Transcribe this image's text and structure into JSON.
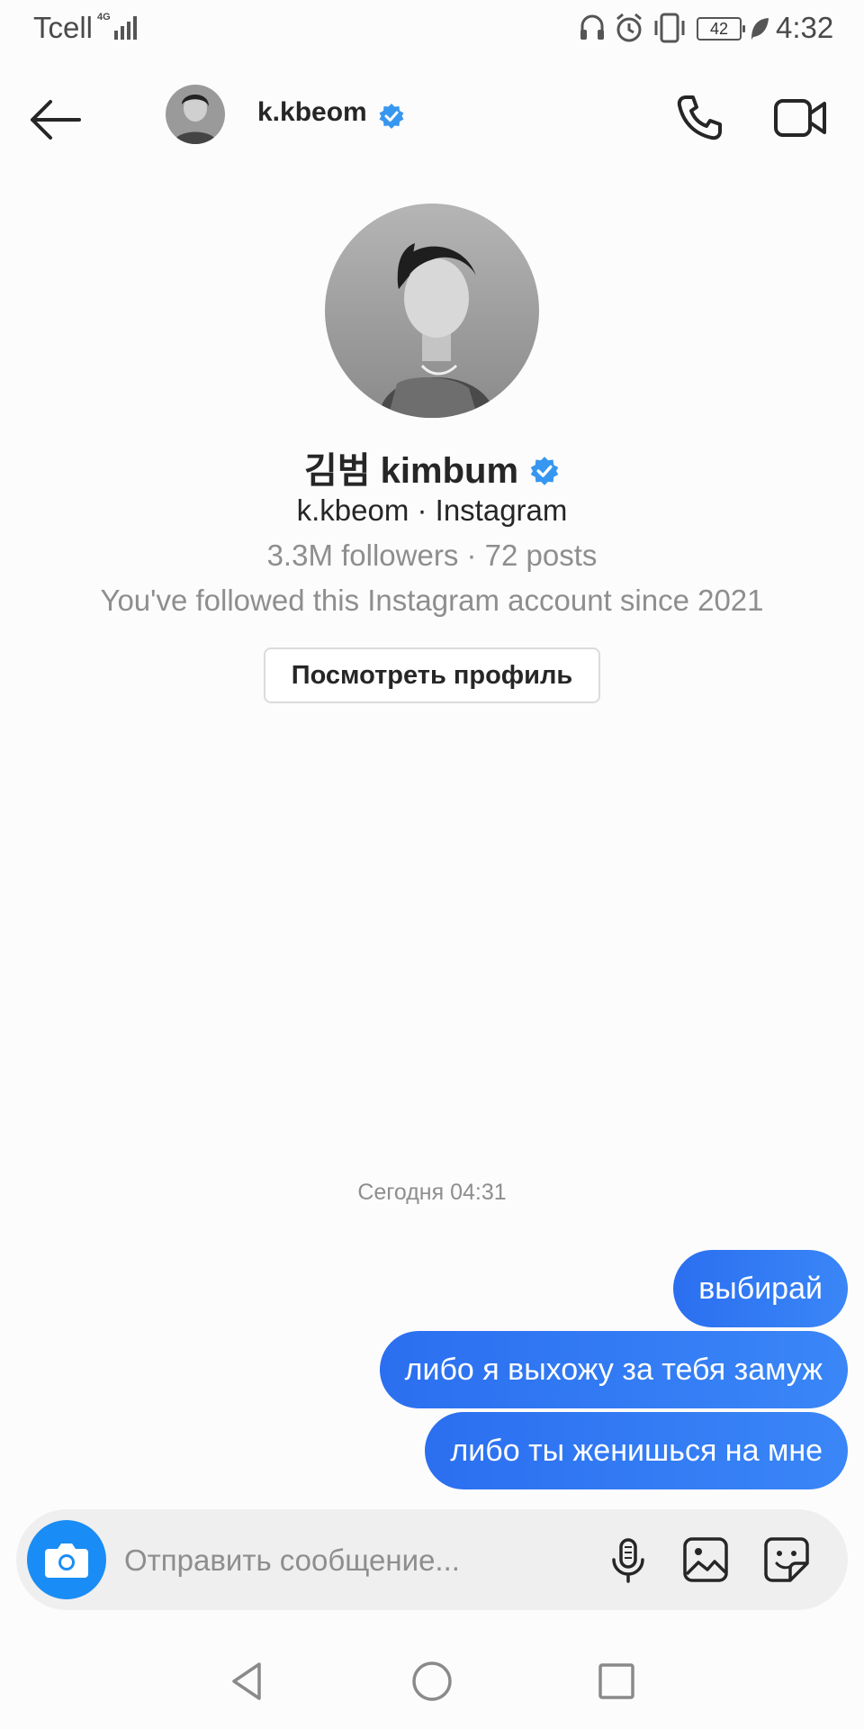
{
  "status_bar": {
    "carrier": "Tcell",
    "network": "4G",
    "battery": "42",
    "time": "4:32",
    "icons": [
      "headset-icon",
      "alarm-icon",
      "vibrate-icon",
      "battery-icon",
      "leaf-icon"
    ]
  },
  "header": {
    "username": "k.kbeom",
    "icons": [
      "back-arrow-icon",
      "phone-icon",
      "video-camera-icon",
      "verified-badge-icon"
    ]
  },
  "profile": {
    "display_name": "김범 kimbum",
    "subtitle": "k.kbeom · Instagram",
    "stats": "3.3M followers · 72 posts",
    "since": "You've followed this Instagram account since 2021",
    "view_profile_label": "Посмотреть профиль"
  },
  "chat": {
    "timestamp": "Сегодня 04:31",
    "messages": [
      {
        "text": "выбирай",
        "sender": "me"
      },
      {
        "text": "либо я выхожу за тебя замуж",
        "sender": "me"
      },
      {
        "text": "либо ты женишься на мне",
        "sender": "me"
      }
    ]
  },
  "composer": {
    "placeholder": "Отправить сообщение...",
    "value": "",
    "icons": [
      "camera-icon",
      "microphone-icon",
      "gallery-icon",
      "sticker-icon"
    ]
  },
  "nav_bar": {
    "icons": [
      "nav-back-icon",
      "nav-home-icon",
      "nav-recents-icon"
    ]
  },
  "colors": {
    "accent_blue": "#3797f0",
    "bubble_blue": "#3a86f7",
    "camera_blue": "#1a8cf5",
    "muted_text": "#8e8e8e"
  }
}
